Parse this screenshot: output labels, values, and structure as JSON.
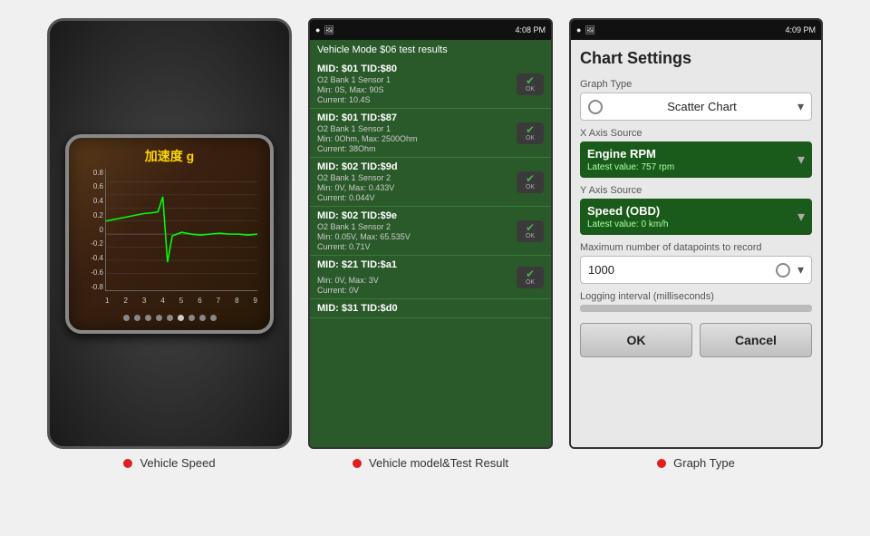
{
  "panel1": {
    "title": "加速度 g",
    "y_labels": [
      "0.8",
      "0.6",
      "0.4",
      "0.2",
      "0",
      "-0.2",
      "-0.4",
      "-0.6",
      "-0.8"
    ],
    "x_labels": [
      "9",
      "8",
      "7",
      "6",
      "5",
      "4",
      "3",
      "2",
      "1"
    ],
    "dots": [
      0,
      0,
      0,
      0,
      0,
      0,
      1,
      0,
      0
    ],
    "label": "Vehicle Speed"
  },
  "panel2": {
    "status_time": "4:08 PM",
    "status_battery": "3%",
    "mode_header": "Vehicle Mode $06 test results",
    "items": [
      {
        "mid": "MID: $01 TID:$80",
        "sensor": "O2 Bank 1 Sensor 1",
        "values": "Min: 0S, Max: 90S",
        "current": "Current: 10.4S",
        "has_ok": true
      },
      {
        "mid": "MID: $01 TID:$87",
        "sensor": "O2 Bank 1 Sensor 1",
        "values": "Min: 0Ohm, Max: 2500Ohm",
        "current": "Current: 38Ohm",
        "has_ok": true
      },
      {
        "mid": "MID: $02 TID:$9d",
        "sensor": "O2 Bank 1 Sensor 2",
        "values": "Min: 0V, Max: 0.433V",
        "current": "Current: 0.044V",
        "has_ok": true
      },
      {
        "mid": "MID: $02 TID:$9e",
        "sensor": "O2 Bank 1 Sensor 2",
        "values": "Min: 0.05V, Max: 65.535V",
        "current": "Current: 0.71V",
        "has_ok": true
      },
      {
        "mid": "MID: $21 TID:$a1",
        "sensor": "",
        "values": "Min: 0V, Max: 3V",
        "current": "Current: 0V",
        "has_ok": true
      },
      {
        "mid": "MID: $31 TID:$d0",
        "sensor": "",
        "values": "",
        "current": "",
        "has_ok": false
      }
    ],
    "label": "Vehicle model&Test Result"
  },
  "panel3": {
    "status_time": "4:09 PM",
    "status_battery": "3%",
    "title": "Chart Settings",
    "graph_type_label": "Graph Type",
    "graph_type_value": "Scatter Chart",
    "x_axis_label": "X Axis Source",
    "x_axis_value": "Engine RPM",
    "x_axis_latest": "Latest value: 757 rpm",
    "y_axis_label": "Y Axis Source",
    "y_axis_value": "Speed (OBD)",
    "y_axis_latest": "Latest value: 0 km/h",
    "max_datapoints_label": "Maximum number of datapoints to record",
    "max_datapoints_value": "1000",
    "logging_label": "Logging interval (milliseconds)",
    "ok_button": "OK",
    "cancel_button": "Cancel",
    "label": "Graph Type"
  }
}
